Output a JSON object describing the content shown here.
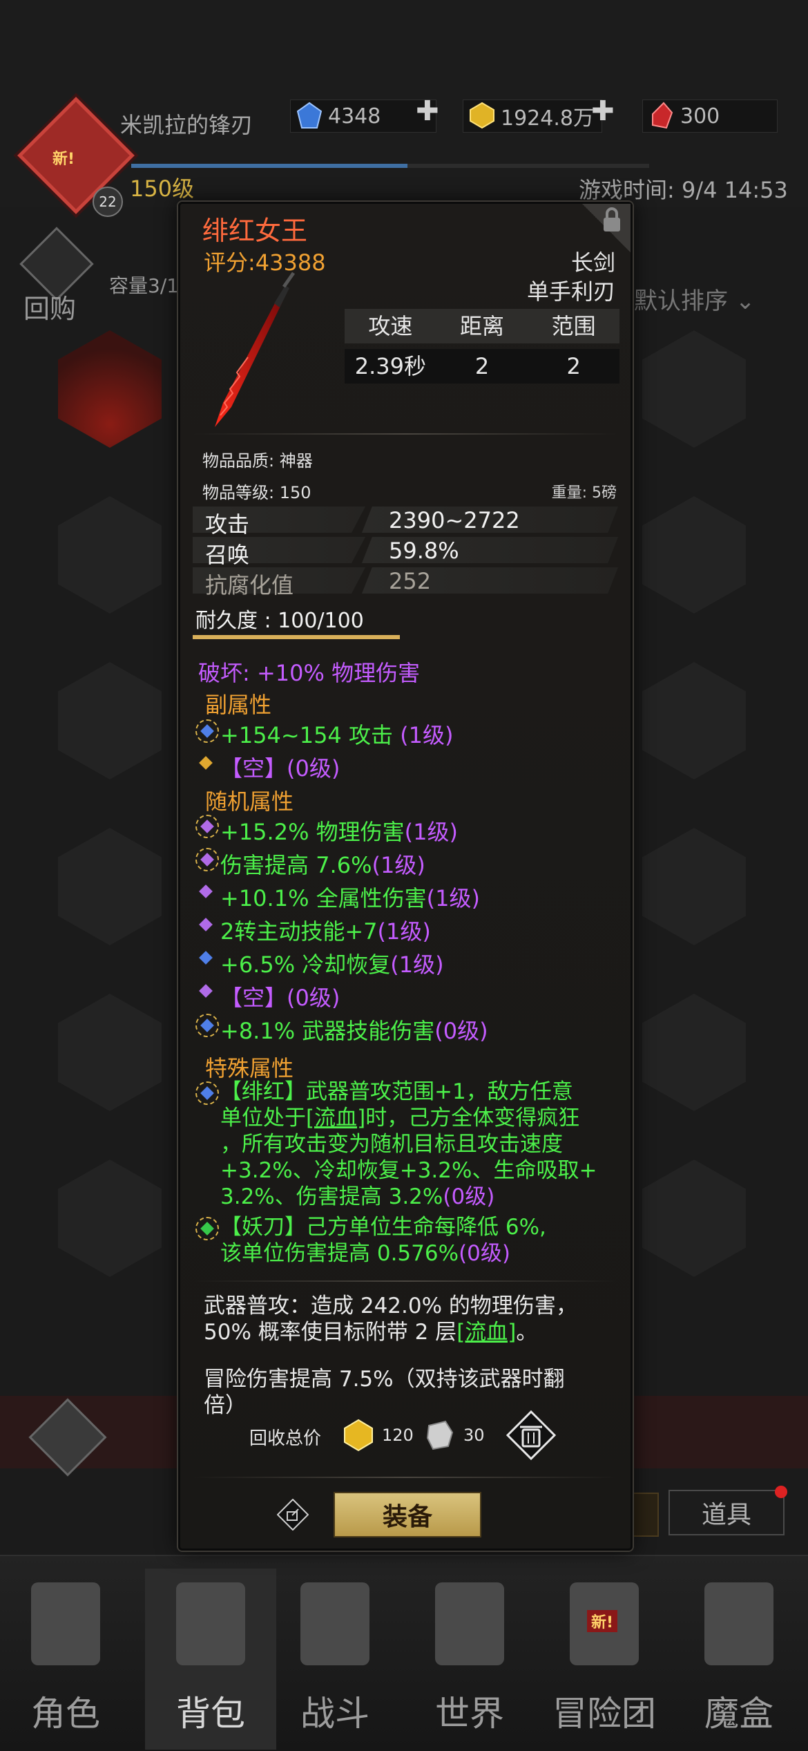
{
  "header": {
    "player_name": "米凯拉的锋刃",
    "new_badge": "新!",
    "avatar_level": "22",
    "player_level": "150级",
    "game_time": "游戏时间: 9/4 14:53",
    "resources": [
      {
        "icon": "blue-gem-icon",
        "value": "4348"
      },
      {
        "icon": "gold-icon",
        "value": "1924.8万"
      },
      {
        "icon": "red-gem-icon",
        "value": "300"
      }
    ]
  },
  "bag": {
    "buyback_label": "回购",
    "capacity_label": "容量3/1",
    "sort_label": "默认排序"
  },
  "side_tabs": {
    "items_label": "道具"
  },
  "bottom_nav": [
    {
      "label": "角色",
      "icon": "helmet-icon"
    },
    {
      "label": "背包",
      "icon": "backpack-icon"
    },
    {
      "label": "战斗",
      "icon": "sword-shield-icon"
    },
    {
      "label": "世界",
      "icon": "map-icon"
    },
    {
      "label": "冒险团",
      "icon": "castle-icon",
      "badge": "新!"
    },
    {
      "label": "魔盒",
      "icon": "cube-icon"
    }
  ],
  "item": {
    "name": "绯红女王",
    "score": "评分:43388",
    "weapon_type": "长剑",
    "weapon_hands": "单手利刃",
    "stats_headers": [
      "攻速",
      "距离",
      "范围"
    ],
    "stats_values": [
      "2.39秒",
      "2",
      "2"
    ],
    "quality": "物品品质: 神器",
    "item_level": "物品等级: 150",
    "weight": "重量: 5磅",
    "attributes": [
      {
        "label": "攻击",
        "value": "2390~2722"
      },
      {
        "label": "召唤",
        "value": "59.8%"
      },
      {
        "label": "抗腐化值",
        "value": "252"
      }
    ],
    "durability": "耐久度 : 100/100",
    "durability_fraction": 1.0,
    "destroy_line": "破坏: +10% 物理伤害",
    "sub_title": "副属性",
    "sub_attrs": [
      {
        "text": "+154~154 攻击",
        "level": " (1级)"
      },
      {
        "text": "【空】",
        "level": "(0级)"
      }
    ],
    "random_title": "随机属性",
    "random_attrs": [
      {
        "text": "+15.2% 物理伤害",
        "level": "(1级)"
      },
      {
        "text": "伤害提高 7.6%",
        "level": "(1级)"
      },
      {
        "text": "+10.1% 全属性伤害",
        "level": "(1级)"
      },
      {
        "text": "2转主动技能+7",
        "level": "(1级)"
      },
      {
        "text": "+6.5% 冷却恢复",
        "level": "(1级)"
      },
      {
        "text": "【空】",
        "level": "(0级)"
      },
      {
        "text": "+8.1% 武器技能伤害",
        "level": "(0级)"
      }
    ],
    "special_title": "特殊属性",
    "special_1": {
      "l1": "【绯红】武器普攻范围+1，敌方任意",
      "l2a": "单位处于",
      "l2b": "[流血]",
      "l2c": "时，己方全体变得疯狂",
      "l3": "，所有攻击变为随机目标且攻击速度",
      "l4": "+3.2%、冷却恢复+3.2%、生命吸取+",
      "l5": "3.2%、伤害提高 3.2%",
      "level": "(0级)"
    },
    "special_2": {
      "l1": "【妖刀】己方单位生命每降低 6%,",
      "l2": "该单位伤害提高 0.576%",
      "level": "(0级)"
    },
    "desc_1a": "武器普攻：造成 242.0% 的物理伤害，",
    "desc_1b": "50% 概率使目标附带 2 层",
    "desc_1c": "[流血]",
    "desc_1d": "。",
    "desc_2a": "冒险伤害提高 7.5%（双持该武器时翻",
    "desc_2b": "倍）",
    "recycle_label": "回收总价",
    "recycle_gold": "120",
    "recycle_scrap": "30",
    "equip_label": "装备"
  },
  "colors": {
    "item_name": "#ff6a3d",
    "score": "#f0a132",
    "green_attr": "#4cf04a",
    "purple_attr": "#c45cff",
    "section": "#f0a132"
  }
}
